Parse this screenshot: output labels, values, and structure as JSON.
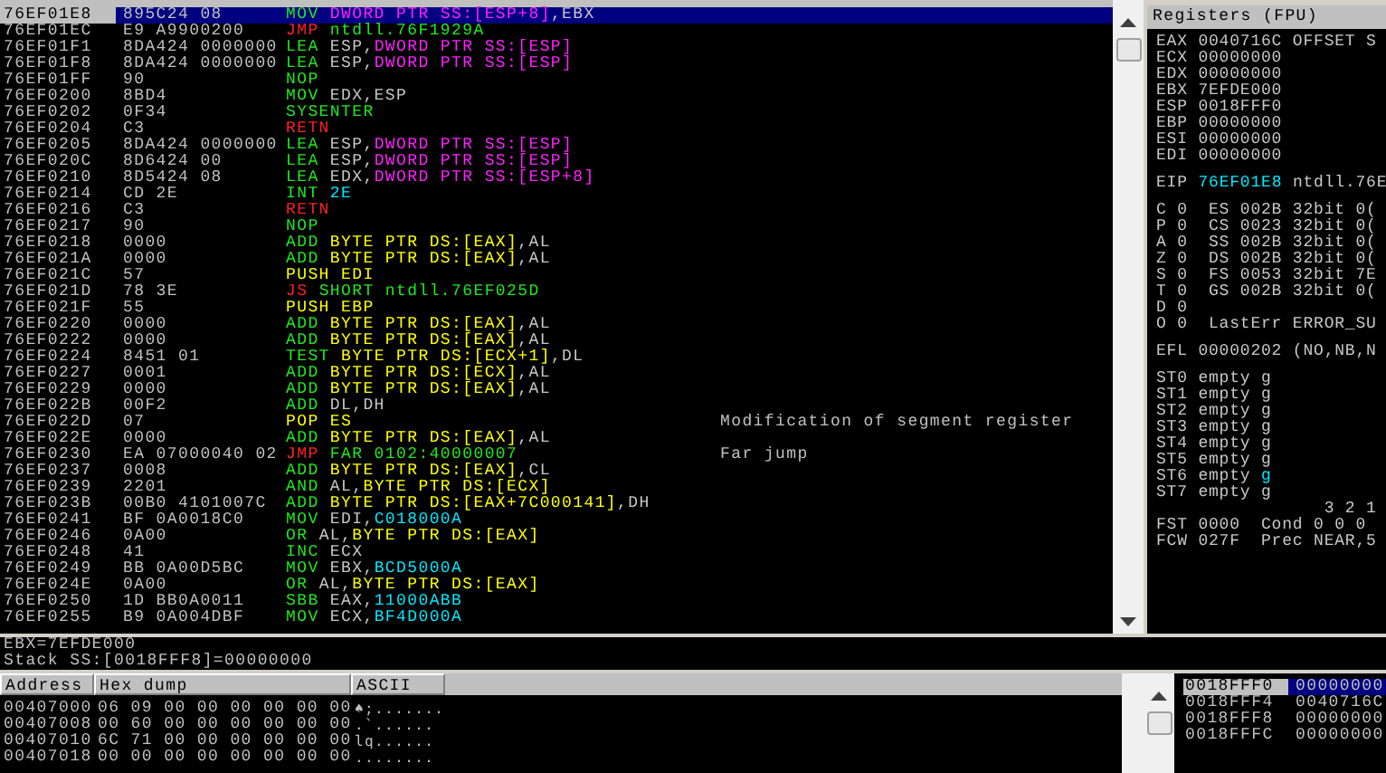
{
  "disassembly": {
    "rows": [
      {
        "address": "76EF01E8",
        "hex": "895C24 08",
        "selected": true,
        "instruction": [
          {
            "text": "MOV ",
            "kind": "op"
          },
          {
            "text": "DWORD PTR SS:[ESP+8]",
            "kind": "stack_mem"
          },
          {
            "text": ",EBX",
            "kind": "plain"
          }
        ]
      },
      {
        "address": "76EF01EC",
        "hex": "E9 A9900200",
        "selected": false,
        "instruction": [
          {
            "text": "JMP ",
            "kind": "flow"
          },
          {
            "text": "ntdll.76F1929A",
            "kind": "op"
          }
        ]
      },
      {
        "address": "76EF01F1",
        "hex": "8DA424 0000000",
        "selected": false,
        "instruction": [
          {
            "text": "LEA ",
            "kind": "op"
          },
          {
            "text": "ESP,",
            "kind": "plain"
          },
          {
            "text": "DWORD PTR SS:[ESP]",
            "kind": "stack_mem"
          }
        ]
      },
      {
        "address": "76EF01F8",
        "hex": "8DA424 0000000",
        "selected": false,
        "instruction": [
          {
            "text": "LEA ",
            "kind": "op"
          },
          {
            "text": "ESP,",
            "kind": "plain"
          },
          {
            "text": "DWORD PTR SS:[ESP]",
            "kind": "stack_mem"
          }
        ]
      },
      {
        "address": "76EF01FF",
        "hex": "90",
        "selected": false,
        "instruction": [
          {
            "text": "NOP",
            "kind": "op"
          }
        ]
      },
      {
        "address": "76EF0200",
        "hex": "8BD4",
        "selected": false,
        "instruction": [
          {
            "text": "MOV ",
            "kind": "op"
          },
          {
            "text": "EDX,ESP",
            "kind": "plain"
          }
        ]
      },
      {
        "address": "76EF0202",
        "hex": "0F34",
        "selected": false,
        "instruction": [
          {
            "text": "SYSENTER",
            "kind": "op"
          }
        ]
      },
      {
        "address": "76EF0204",
        "hex": "C3",
        "selected": false,
        "instruction": [
          {
            "text": "RETN",
            "kind": "flow"
          }
        ]
      },
      {
        "address": "76EF0205",
        "hex": "8DA424 0000000",
        "selected": false,
        "instruction": [
          {
            "text": "LEA ",
            "kind": "op"
          },
          {
            "text": "ESP,",
            "kind": "plain"
          },
          {
            "text": "DWORD PTR SS:[ESP]",
            "kind": "stack_mem"
          }
        ]
      },
      {
        "address": "76EF020C",
        "hex": "8D6424 00",
        "selected": false,
        "instruction": [
          {
            "text": "LEA ",
            "kind": "op"
          },
          {
            "text": "ESP,",
            "kind": "plain"
          },
          {
            "text": "DWORD PTR SS:[ESP]",
            "kind": "stack_mem"
          }
        ]
      },
      {
        "address": "76EF0210",
        "hex": "8D5424 08",
        "selected": false,
        "instruction": [
          {
            "text": "LEA ",
            "kind": "op"
          },
          {
            "text": "EDX,",
            "kind": "plain"
          },
          {
            "text": "DWORD PTR SS:[ESP+8]",
            "kind": "stack_mem"
          }
        ]
      },
      {
        "address": "76EF0214",
        "hex": "CD 2E",
        "selected": false,
        "instruction": [
          {
            "text": "INT ",
            "kind": "op"
          },
          {
            "text": "2E",
            "kind": "const"
          }
        ]
      },
      {
        "address": "76EF0216",
        "hex": "C3",
        "selected": false,
        "instruction": [
          {
            "text": "RETN",
            "kind": "flow"
          }
        ]
      },
      {
        "address": "76EF0217",
        "hex": "90",
        "selected": false,
        "instruction": [
          {
            "text": "NOP",
            "kind": "op"
          }
        ]
      },
      {
        "address": "76EF0218",
        "hex": "0000",
        "selected": false,
        "instruction": [
          {
            "text": "ADD ",
            "kind": "op"
          },
          {
            "text": "BYTE PTR DS:[EAX]",
            "kind": "data_mem"
          },
          {
            "text": ",AL",
            "kind": "plain"
          }
        ]
      },
      {
        "address": "76EF021A",
        "hex": "0000",
        "selected": false,
        "instruction": [
          {
            "text": "ADD ",
            "kind": "op"
          },
          {
            "text": "BYTE PTR DS:[EAX]",
            "kind": "data_mem"
          },
          {
            "text": ",AL",
            "kind": "plain"
          }
        ]
      },
      {
        "address": "76EF021C",
        "hex": "57",
        "selected": false,
        "instruction": [
          {
            "text": "PUSH EDI",
            "kind": "stack_op"
          }
        ]
      },
      {
        "address": "76EF021D",
        "hex": "78 3E",
        "selected": false,
        "instruction": [
          {
            "text": "JS ",
            "kind": "flow"
          },
          {
            "text": "SHORT ntdll.76EF025D",
            "kind": "op"
          }
        ]
      },
      {
        "address": "76EF021F",
        "hex": "55",
        "selected": false,
        "instruction": [
          {
            "text": "PUSH EBP",
            "kind": "stack_op"
          }
        ]
      },
      {
        "address": "76EF0220",
        "hex": "0000",
        "selected": false,
        "instruction": [
          {
            "text": "ADD ",
            "kind": "op"
          },
          {
            "text": "BYTE PTR DS:[EAX]",
            "kind": "data_mem"
          },
          {
            "text": ",AL",
            "kind": "plain"
          }
        ]
      },
      {
        "address": "76EF0222",
        "hex": "0000",
        "selected": false,
        "instruction": [
          {
            "text": "ADD ",
            "kind": "op"
          },
          {
            "text": "BYTE PTR DS:[EAX]",
            "kind": "data_mem"
          },
          {
            "text": ",AL",
            "kind": "plain"
          }
        ]
      },
      {
        "address": "76EF0224",
        "hex": "8451 01",
        "selected": false,
        "instruction": [
          {
            "text": "TEST ",
            "kind": "op"
          },
          {
            "text": "BYTE PTR DS:[ECX+1]",
            "kind": "data_mem"
          },
          {
            "text": ",DL",
            "kind": "plain"
          }
        ]
      },
      {
        "address": "76EF0227",
        "hex": "0001",
        "selected": false,
        "instruction": [
          {
            "text": "ADD ",
            "kind": "op"
          },
          {
            "text": "BYTE PTR DS:[ECX]",
            "kind": "data_mem"
          },
          {
            "text": ",AL",
            "kind": "plain"
          }
        ]
      },
      {
        "address": "76EF0229",
        "hex": "0000",
        "selected": false,
        "instruction": [
          {
            "text": "ADD ",
            "kind": "op"
          },
          {
            "text": "BYTE PTR DS:[EAX]",
            "kind": "data_mem"
          },
          {
            "text": ",AL",
            "kind": "plain"
          }
        ]
      },
      {
        "address": "76EF022B",
        "hex": "00F2",
        "selected": false,
        "instruction": [
          {
            "text": "ADD ",
            "kind": "op"
          },
          {
            "text": "DL,DH",
            "kind": "plain"
          }
        ]
      },
      {
        "address": "76EF022D",
        "hex": "07",
        "selected": false,
        "instruction": [
          {
            "text": "POP ES",
            "kind": "stack_op"
          }
        ],
        "comment": "Modification of segment register"
      },
      {
        "address": "76EF022E",
        "hex": "0000",
        "selected": false,
        "instruction": [
          {
            "text": "ADD ",
            "kind": "op"
          },
          {
            "text": "BYTE PTR DS:[EAX]",
            "kind": "data_mem"
          },
          {
            "text": ",AL",
            "kind": "plain"
          }
        ]
      },
      {
        "address": "76EF0230",
        "hex": "EA 07000040 02",
        "selected": false,
        "instruction": [
          {
            "text": "JMP ",
            "kind": "flow"
          },
          {
            "text": "FAR 0102:40000007",
            "kind": "op"
          }
        ],
        "comment": "Far jump"
      },
      {
        "address": "76EF0237",
        "hex": "0008",
        "selected": false,
        "instruction": [
          {
            "text": "ADD ",
            "kind": "op"
          },
          {
            "text": "BYTE PTR DS:[EAX]",
            "kind": "data_mem"
          },
          {
            "text": ",CL",
            "kind": "plain"
          }
        ]
      },
      {
        "address": "76EF0239",
        "hex": "2201",
        "selected": false,
        "instruction": [
          {
            "text": "AND ",
            "kind": "op"
          },
          {
            "text": "AL,",
            "kind": "plain"
          },
          {
            "text": "BYTE PTR DS:[ECX]",
            "kind": "data_mem"
          }
        ]
      },
      {
        "address": "76EF023B",
        "hex": "00B0 4101007C",
        "selected": false,
        "instruction": [
          {
            "text": "ADD ",
            "kind": "op"
          },
          {
            "text": "BYTE PTR DS:[EAX+7C000141]",
            "kind": "data_mem"
          },
          {
            "text": ",DH",
            "kind": "plain"
          }
        ]
      },
      {
        "address": "76EF0241",
        "hex": "BF 0A0018C0",
        "selected": false,
        "instruction": [
          {
            "text": "MOV ",
            "kind": "op"
          },
          {
            "text": "EDI,",
            "kind": "plain"
          },
          {
            "text": "C018000A",
            "kind": "const"
          }
        ]
      },
      {
        "address": "76EF0246",
        "hex": "0A00",
        "selected": false,
        "instruction": [
          {
            "text": "OR ",
            "kind": "op"
          },
          {
            "text": "AL,",
            "kind": "plain"
          },
          {
            "text": "BYTE PTR DS:[EAX]",
            "kind": "data_mem"
          }
        ]
      },
      {
        "address": "76EF0248",
        "hex": "41",
        "selected": false,
        "instruction": [
          {
            "text": "INC ",
            "kind": "op"
          },
          {
            "text": "ECX",
            "kind": "plain"
          }
        ]
      },
      {
        "address": "76EF0249",
        "hex": "BB 0A00D5BC",
        "selected": false,
        "instruction": [
          {
            "text": "MOV ",
            "kind": "op"
          },
          {
            "text": "EBX,",
            "kind": "plain"
          },
          {
            "text": "BCD5000A",
            "kind": "const"
          }
        ]
      },
      {
        "address": "76EF024E",
        "hex": "0A00",
        "selected": false,
        "instruction": [
          {
            "text": "OR ",
            "kind": "op"
          },
          {
            "text": "AL,",
            "kind": "plain"
          },
          {
            "text": "BYTE PTR DS:[EAX]",
            "kind": "data_mem"
          }
        ]
      },
      {
        "address": "76EF0250",
        "hex": "1D BB0A0011",
        "selected": false,
        "instruction": [
          {
            "text": "SBB ",
            "kind": "op"
          },
          {
            "text": "EAX,",
            "kind": "plain"
          },
          {
            "text": "11000ABB",
            "kind": "const"
          }
        ]
      },
      {
        "address": "76EF0255",
        "hex": "B9 0A004DBF",
        "selected": false,
        "instruction": [
          {
            "text": "MOV ",
            "kind": "op"
          },
          {
            "text": "ECX,",
            "kind": "plain"
          },
          {
            "text": "BF4D000A",
            "kind": "const"
          }
        ]
      }
    ]
  },
  "registers": {
    "title": "Registers (FPU)",
    "groups": [
      [
        {
          "segments": [
            {
              "text": "EAX 0040716C OFFSET S",
              "changed": false
            }
          ]
        },
        {
          "segments": [
            {
              "text": "ECX 00000000",
              "changed": false
            }
          ]
        },
        {
          "segments": [
            {
              "text": "EDX 00000000",
              "changed": false
            }
          ]
        },
        {
          "segments": [
            {
              "text": "EBX 7EFDE000",
              "changed": false
            }
          ]
        },
        {
          "segments": [
            {
              "text": "ESP 0018FFF0",
              "changed": false
            }
          ]
        },
        {
          "segments": [
            {
              "text": "EBP 00000000",
              "changed": false
            }
          ]
        },
        {
          "segments": [
            {
              "text": "ESI 00000000",
              "changed": false
            }
          ]
        },
        {
          "segments": [
            {
              "text": "EDI 00000000",
              "changed": false
            }
          ]
        }
      ],
      [
        {
          "segments": [
            {
              "text": "EIP ",
              "changed": false
            },
            {
              "text": "76EF01E8",
              "changed": true
            },
            {
              "text": " ntdll.76E",
              "changed": false
            }
          ]
        }
      ],
      [
        {
          "segments": [
            {
              "text": "C 0  ES 002B 32bit 0(",
              "changed": false
            }
          ]
        },
        {
          "segments": [
            {
              "text": "P 0  CS 0023 32bit 0(",
              "changed": false
            }
          ]
        },
        {
          "segments": [
            {
              "text": "A 0  SS 002B 32bit 0(",
              "changed": false
            }
          ]
        },
        {
          "segments": [
            {
              "text": "Z 0  DS 002B 32bit 0(",
              "changed": false
            }
          ]
        },
        {
          "segments": [
            {
              "text": "S 0  FS 0053 32bit 7E",
              "changed": false
            }
          ]
        },
        {
          "segments": [
            {
              "text": "T 0  GS 002B 32bit 0(",
              "changed": false
            }
          ]
        },
        {
          "segments": [
            {
              "text": "D 0",
              "changed": false
            }
          ]
        },
        {
          "segments": [
            {
              "text": "O 0  LastErr ERROR_SU",
              "changed": false
            }
          ]
        }
      ],
      [
        {
          "segments": [
            {
              "text": "EFL 00000202 (NO,NB,N",
              "changed": false
            }
          ]
        }
      ],
      [
        {
          "segments": [
            {
              "text": "ST0 empty g",
              "changed": false
            }
          ]
        },
        {
          "segments": [
            {
              "text": "ST1 empty g",
              "changed": false
            }
          ]
        },
        {
          "segments": [
            {
              "text": "ST2 empty g",
              "changed": false
            }
          ]
        },
        {
          "segments": [
            {
              "text": "ST3 empty g",
              "changed": false
            }
          ]
        },
        {
          "segments": [
            {
              "text": "ST4 empty g",
              "changed": false
            }
          ]
        },
        {
          "segments": [
            {
              "text": "ST5 empty g",
              "changed": false
            }
          ]
        },
        {
          "segments": [
            {
              "text": "ST6 empty ",
              "changed": false
            },
            {
              "text": "g",
              "changed": true
            }
          ]
        },
        {
          "segments": [
            {
              "text": "ST7 empty g",
              "changed": false
            }
          ]
        },
        {
          "segments": [
            {
              "text": "                3 2 1",
              "changed": false
            }
          ]
        },
        {
          "segments": [
            {
              "text": "FST 0000  Cond 0 0 0",
              "changed": false
            }
          ]
        },
        {
          "segments": [
            {
              "text": "FCW 027F  Prec NEAR,5",
              "changed": false
            }
          ]
        }
      ]
    ]
  },
  "info": [
    "EBX=7EFDE000",
    "Stack SS:[0018FFF8]=00000000"
  ],
  "dump": {
    "columns": [
      "Address",
      "Hex dump",
      "ASCII"
    ],
    "rows": [
      {
        "address": "00407000",
        "hex": "06 09 00 00 00 00 00 00",
        "ascii": "♠;......."
      },
      {
        "address": "00407008",
        "hex": "00 60 00 00 00 00 00 00",
        "ascii": ".`......"
      },
      {
        "address": "00407010",
        "hex": "6C 71 00 00 00 00 00 00",
        "ascii": "lq......"
      },
      {
        "address": "00407018",
        "hex": "00 00 00 00 00 00 00 00",
        "ascii": "........"
      }
    ]
  },
  "stack": {
    "rows": [
      {
        "address": "0018FFF0",
        "value": "00000000",
        "selected": true
      },
      {
        "address": "0018FFF4",
        "value": "0040716C",
        "selected": false
      },
      {
        "address": "0018FFF8",
        "value": "00000000",
        "selected": false
      },
      {
        "address": "0018FFFC",
        "value": "00000000",
        "selected": false
      }
    ]
  }
}
